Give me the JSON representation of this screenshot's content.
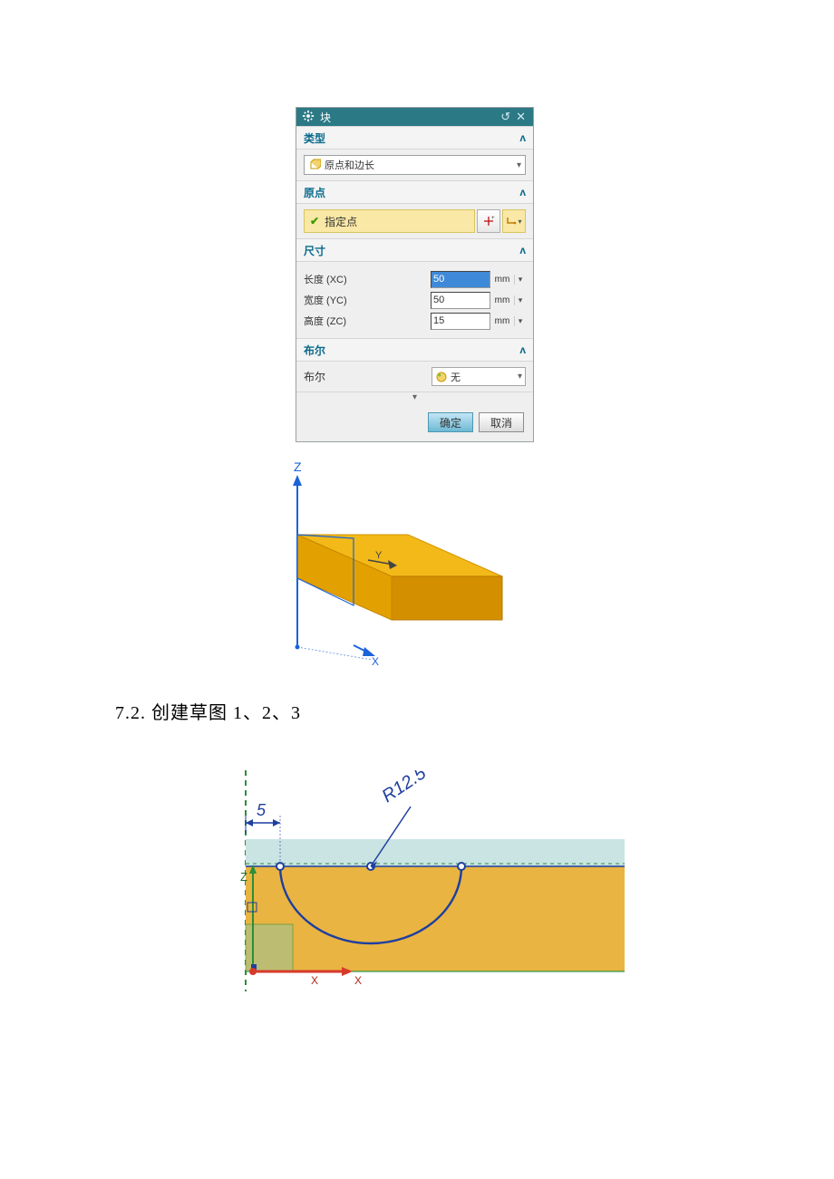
{
  "dialog": {
    "title": "块",
    "sections": {
      "type": {
        "label": "类型",
        "combo": "原点和边长"
      },
      "origin": {
        "label": "原点",
        "point_label": "指定点"
      },
      "dims": {
        "label": "尺寸",
        "rows": [
          {
            "label": "长度 (XC)",
            "value": "50",
            "unit": "mm",
            "selected": true
          },
          {
            "label": "宽度 (YC)",
            "value": "50",
            "unit": "mm",
            "selected": false
          },
          {
            "label": "高度 (ZC)",
            "value": "15",
            "unit": "mm",
            "selected": false
          }
        ]
      },
      "boolean": {
        "label": "布尔",
        "field_label": "布尔",
        "value": "无"
      }
    },
    "buttons": {
      "ok": "确定",
      "cancel": "取消"
    }
  },
  "axes3d": {
    "z": "Z",
    "y": "Y",
    "x": "X"
  },
  "heading": "7.2. 创建草图 1、2、3",
  "sketch": {
    "dim_linear": "5",
    "dim_radius": "R12.5",
    "axis_z": "Z",
    "axis_x": "X"
  }
}
